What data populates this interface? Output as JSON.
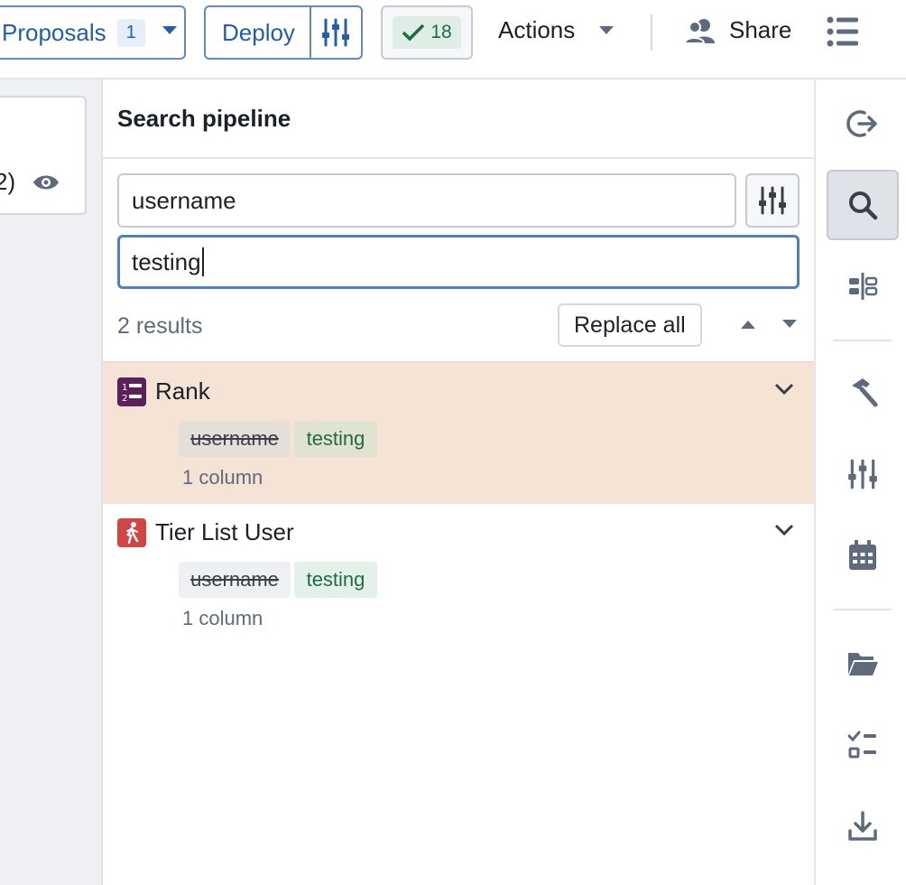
{
  "toolbar": {
    "proposals_label": "Proposals",
    "proposals_count": "1",
    "deploy_label": "Deploy",
    "checks_count": "18",
    "actions_label": "Actions",
    "share_label": "Share"
  },
  "canvas": {
    "node_partial_text": "2)"
  },
  "panel": {
    "title": "Search pipeline",
    "search_value": "username",
    "replace_value": "testing",
    "results_count": "2 results",
    "replace_all_label": "Replace all",
    "results": [
      {
        "name": "Rank",
        "icon": "rank-icon",
        "old_value": "username",
        "new_value": "testing",
        "meta": "1 column"
      },
      {
        "name": "Tier List User",
        "icon": "user-running-icon",
        "old_value": "username",
        "new_value": "testing",
        "meta": "1 column"
      }
    ]
  },
  "rail": {
    "icons": [
      "exit-icon",
      "search-icon",
      "split-view-icon",
      "hammer-icon",
      "sliders-icon",
      "calendar-icon",
      "folder-icon",
      "checklist-icon",
      "download-icon"
    ]
  },
  "colors": {
    "accent": "#215db0",
    "selected_result_bg": "#f5e4d6",
    "success": "#1c6e42",
    "rank_icon_bg": "#5b1f5a",
    "user_icon_bg": "#d24545"
  }
}
